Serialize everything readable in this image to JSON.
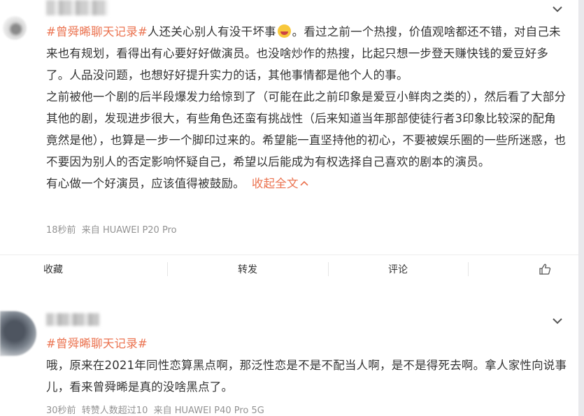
{
  "posts": [
    {
      "topic": "#曾舜晞聊天记录#",
      "paragraphs": [
        {
          "before_emoji": "人还关心别人有没干坏事",
          "emoji": "laughing-emoji-icon",
          "after_emoji": "。看过之前一个热搜，价值观啥都还不错，对自己未来也有规划，看得出有心要好好做演员。也没啥炒作的热搜，比起只想一步登天赚快钱的爱豆好多了。人品没问题，也想好好提升实力的话，其他事情都是他个人的事。"
        },
        {
          "text": "之前被他一个剧的后半段爆发力给惊到了（可能在此之前印象是爱豆小鲜肉之类的），然后看了大部分其他的剧，发现进步很大，有些角色还蛮有挑战性（后来知道当年那部使徒行者3印象比较深的配角竟然是他），也算是一步一个脚印过来的。希望能一直坚持他的初心，不要被娱乐圈的一些所迷惑，也不要因为别人的否定影响怀疑自己，希望以后能成为有权选择自己喜欢的剧本的演员。"
        },
        {
          "text": "有心做一个好演员，应该值得被鼓励。"
        }
      ],
      "collapse_label": "收起全文",
      "collapse_icon": "chevron-up-icon",
      "meta": "18秒前  来自 HUAWEI P20 Pro"
    },
    {
      "topic": "#曾舜晞聊天记录#",
      "paragraphs": [
        {
          "text": "哦，原来在2021年同性恋算黑点啊，那泛性恋是不是不配当人啊，是不是得死去啊。拿人家性向说事儿，看来曾舜晞是真的没啥黑点了。"
        }
      ],
      "meta": "30秒前  转赞人数超过10  来自 HUAWEI P40 Pro 5G"
    }
  ],
  "actions": {
    "favorite": "收藏",
    "repost": "转发",
    "comment": "评论",
    "like_icon": "thumbs-up-icon"
  },
  "colors": {
    "topic": "#eb7350",
    "text": "#333333",
    "meta": "#939393",
    "background": "#f2f2f5"
  }
}
